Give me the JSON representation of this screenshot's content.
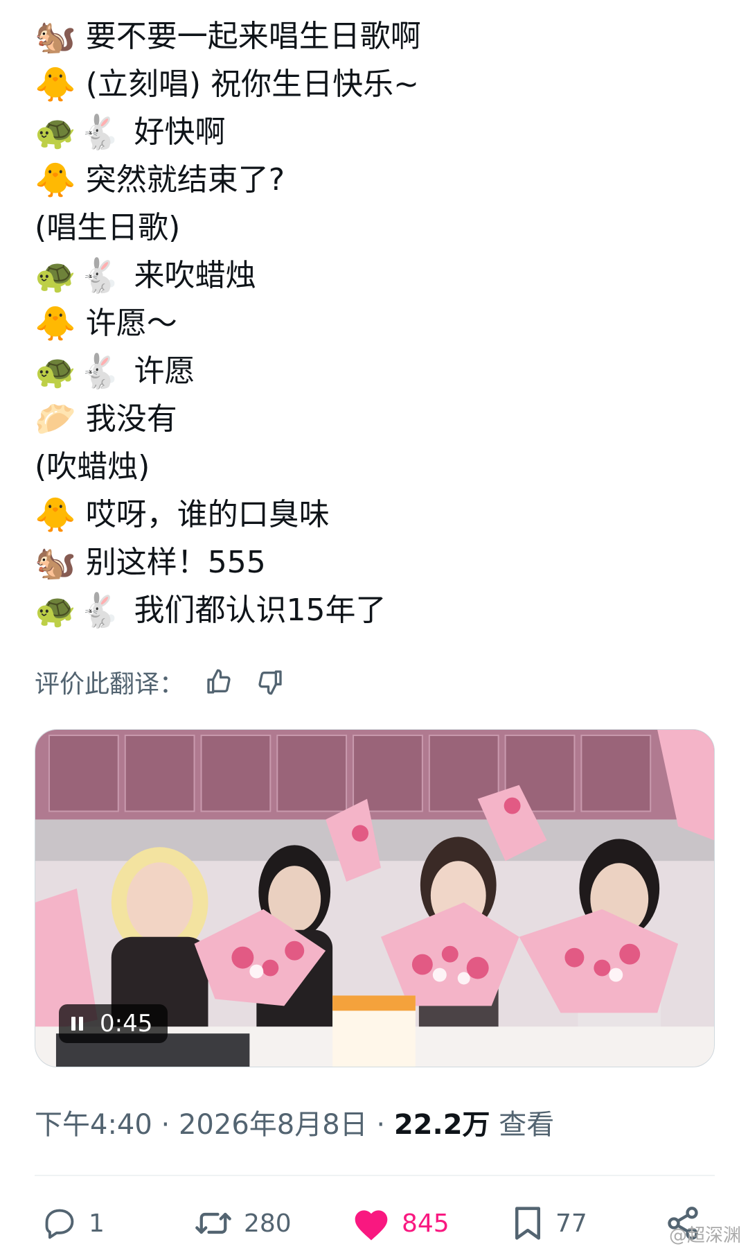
{
  "translation": {
    "lines": [
      {
        "emoji": "🐿️",
        "text": "要不要一起来唱生日歌啊"
      },
      {
        "emoji": "🐥",
        "text": "(立刻唱) 祝你生日快乐~"
      },
      {
        "emoji_pair": [
          "🐢",
          "🐇"
        ],
        "text": "好快啊"
      },
      {
        "emoji": "🐥",
        "text": "突然就结束了?"
      },
      {
        "text": "(唱生日歌)"
      },
      {
        "emoji_pair": [
          "🐢",
          "🐇"
        ],
        "text": "来吹蜡烛"
      },
      {
        "emoji": "🐥",
        "text": "许愿～"
      },
      {
        "emoji_pair": [
          "🐢",
          "🐇"
        ],
        "text": "许愿"
      },
      {
        "emoji": "🥟",
        "text": "我没有"
      },
      {
        "text": "(吹蜡烛)"
      },
      {
        "emoji": "🐥",
        "text": "哎呀，谁的口臭味"
      },
      {
        "emoji": "🐿️",
        "text": "别这样！555"
      },
      {
        "emoji_pair": [
          "🐢",
          "🐇"
        ],
        "text": "我们都认识15年了"
      }
    ],
    "rate_label": "评价此翻译："
  },
  "video": {
    "time": "0:45"
  },
  "meta": {
    "time": "下午4:40",
    "date": "2026年8月8日",
    "views_count": "22.2万",
    "views_label": "查看"
  },
  "actions": {
    "reply": "1",
    "retweet": "280",
    "like": "845",
    "bookmark": "77"
  },
  "watermark": "@超深渊",
  "colors": {
    "like": "#f91880",
    "muted": "#536471",
    "text": "#0f1419"
  }
}
